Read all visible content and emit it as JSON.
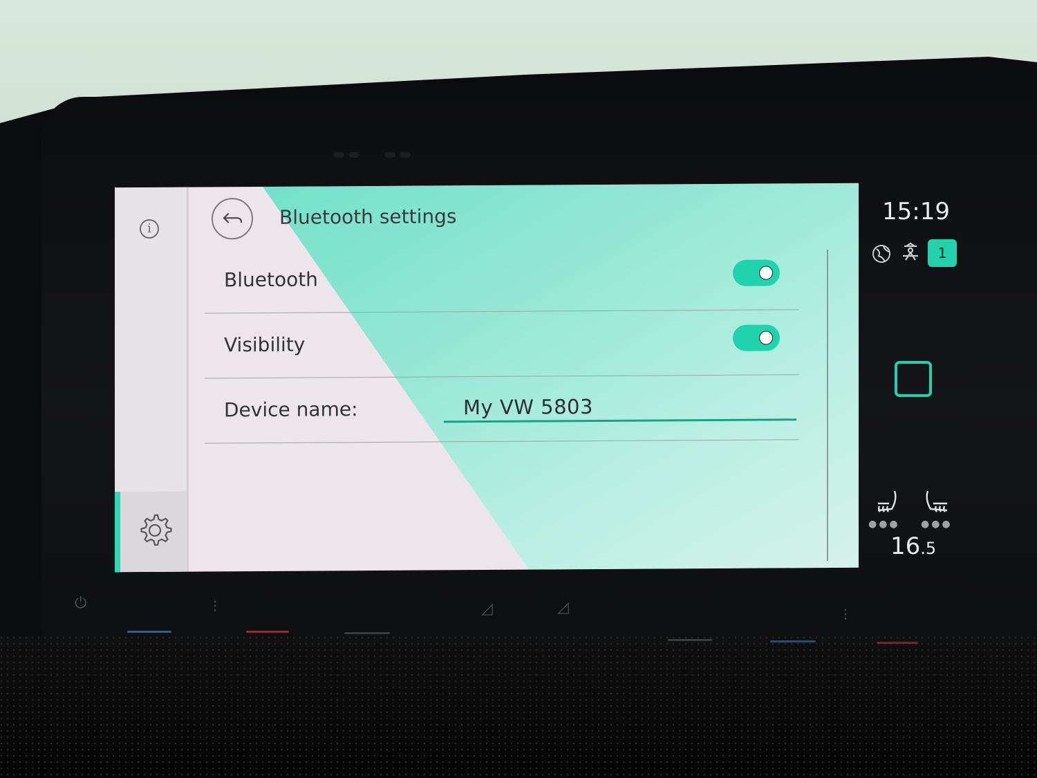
{
  "header": {
    "title": "Bluetooth settings",
    "back_icon": "back-arrow-icon"
  },
  "sidebar": {
    "info_icon_glyph": "i",
    "active_item": "settings"
  },
  "settings": [
    {
      "label": "Bluetooth",
      "type": "toggle",
      "enabled": true
    },
    {
      "label": "Visibility",
      "type": "toggle",
      "enabled": true
    }
  ],
  "device_name": {
    "label": "Device name:",
    "value": "My VW 5803"
  },
  "status": {
    "time": "15:19",
    "badge": "1",
    "temperature_main": "16",
    "temperature_decimal": ".5"
  },
  "colors": {
    "accent": "#23d2ad",
    "field_underline": "#16a383",
    "screen_background": "#ece6ea"
  }
}
